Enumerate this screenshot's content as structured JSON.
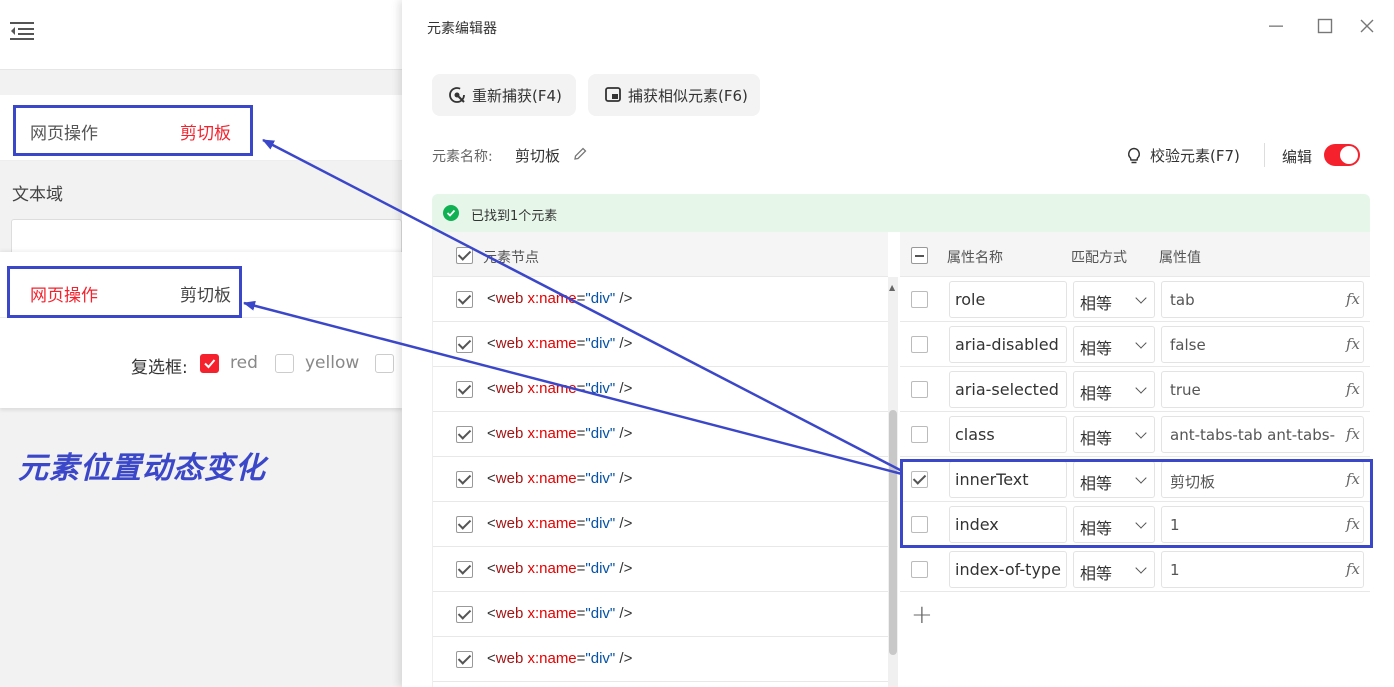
{
  "left_app": {
    "tab_web": "网页操作",
    "tab_clipboard": "剪切板",
    "textarea_label": "文本域",
    "checkbox_label": "复选框:",
    "checkbox_options": [
      "red",
      "yellow"
    ],
    "caption": "元素位置动态变化"
  },
  "editor": {
    "window_title": "元素编辑器",
    "recapture_label": "重新捕获(F4)",
    "capture_similar_label": "捕获相似元素(F6)",
    "name_label": "元素名称:",
    "name_value": "剪切板",
    "verify_label": "校验元素(F7)",
    "edit_label": "编辑",
    "edit_enabled": true,
    "found_text": "已找到1个元素",
    "node_header": "元素节点",
    "nodes": [
      {
        "open": "<",
        "web": "web",
        "attr": " x:name",
        "eq": "=",
        "val": "\"div\"",
        "close": " />"
      },
      {
        "open": "<",
        "web": "web",
        "attr": " x:name",
        "eq": "=",
        "val": "\"div\"",
        "close": " />"
      },
      {
        "open": "<",
        "web": "web",
        "attr": " x:name",
        "eq": "=",
        "val": "\"div\"",
        "close": " />"
      },
      {
        "open": "<",
        "web": "web",
        "attr": " x:name",
        "eq": "=",
        "val": "\"div\"",
        "close": " />"
      },
      {
        "open": "<",
        "web": "web",
        "attr": " x:name",
        "eq": "=",
        "val": "\"div\"",
        "close": " />"
      },
      {
        "open": "<",
        "web": "web",
        "attr": " x:name",
        "eq": "=",
        "val": "\"div\"",
        "close": " />"
      },
      {
        "open": "<",
        "web": "web",
        "attr": " x:name",
        "eq": "=",
        "val": "\"div\"",
        "close": " />"
      },
      {
        "open": "<",
        "web": "web",
        "attr": " x:name",
        "eq": "=",
        "val": "\"div\"",
        "close": " />"
      },
      {
        "open": "<",
        "web": "web",
        "attr": " x:name",
        "eq": "=",
        "val": "\"div\"",
        "close": " />"
      }
    ],
    "attr_headers": {
      "name": "属性名称",
      "match": "匹配方式",
      "value": "属性值"
    },
    "fx_label": "fx",
    "add_label": "+",
    "attributes": [
      {
        "name": "role",
        "match": "相等",
        "value": "tab",
        "checked": false
      },
      {
        "name": "aria-disabled",
        "match": "相等",
        "value": "false",
        "checked": false
      },
      {
        "name": "aria-selected",
        "match": "相等",
        "value": "true",
        "checked": false
      },
      {
        "name": "class",
        "match": "相等",
        "value": "ant-tabs-tab ant-tabs-tab-active",
        "checked": false
      },
      {
        "name": "innerText",
        "match": "相等",
        "value": "剪切板",
        "checked": true
      },
      {
        "name": "index",
        "match": "相等",
        "value": "1",
        "checked": false
      },
      {
        "name": "index-of-type",
        "match": "相等",
        "value": "1",
        "checked": false
      }
    ]
  },
  "colors": {
    "accent_red": "#f5222d",
    "annotation_blue": "#3b47c9",
    "success_green": "#10b152"
  }
}
